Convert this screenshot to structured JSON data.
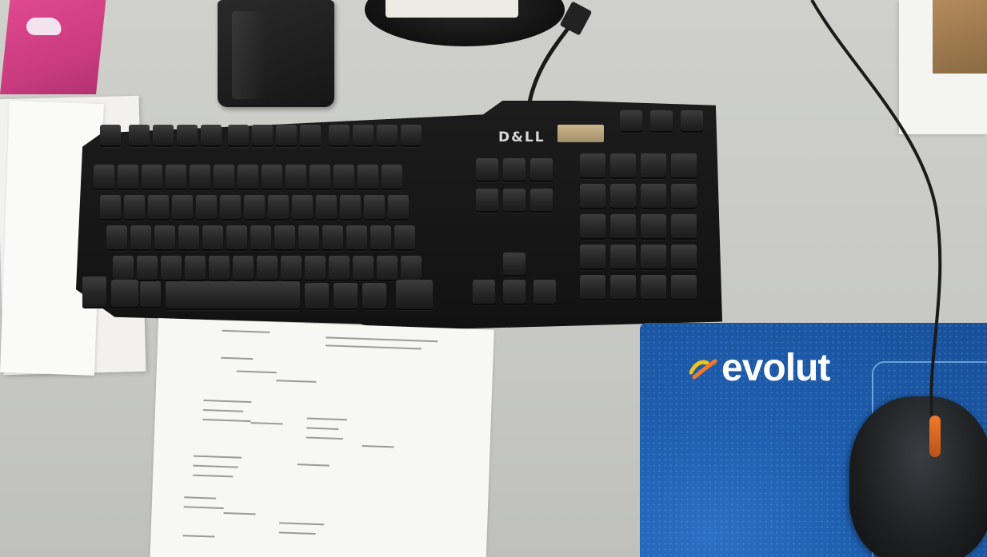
{
  "scene": {
    "keyboard_brand": "D&LL",
    "mousepad_brand": "evolut",
    "colors": {
      "desk": "#c9cac6",
      "keyboard": "#161616",
      "mousepad": "#1f5fb0",
      "folder": "#d3428a",
      "mouse_wheel": "#f07a2a",
      "logo_yellow": "#f2c21a",
      "logo_orange": "#f07a2a"
    }
  }
}
